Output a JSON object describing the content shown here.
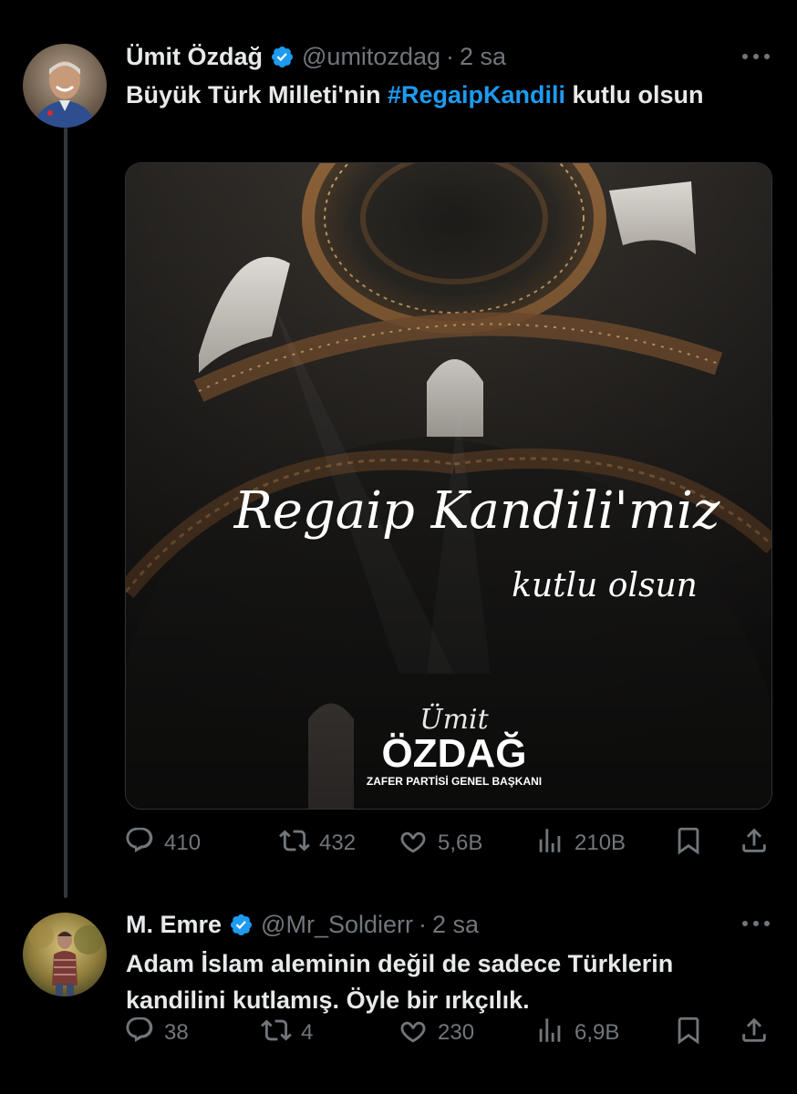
{
  "tweets": [
    {
      "name": "Ümit Özdağ",
      "handle": "@umitozdag",
      "separator": "·",
      "time": "2 sa",
      "text_before": "Büyük Türk Milleti'nin ",
      "hashtag": "#RegaipKandili",
      "text_after": " kutlu olsun",
      "media": {
        "title": "Regaip Kandili'miz",
        "subtitle": "kutlu olsun",
        "logo_script": "Ümit",
        "logo_name": "ÖZDAĞ",
        "logo_caption": "ZAFER PARTİSİ GENEL BAŞKANI"
      },
      "stats": {
        "replies": "410",
        "reposts": "432",
        "likes": "5,6B",
        "views": "210B"
      }
    },
    {
      "name": "M. Emre",
      "handle": "@Mr_Soldierr",
      "separator": "·",
      "time": "2 sa",
      "text": "Adam İslam aleminin değil de sadece Türklerin kandilini kutlamış. Öyle bir ırkçılık.",
      "stats": {
        "replies": "38",
        "reposts": "4",
        "likes": "230",
        "views": "6,9B"
      }
    }
  ],
  "icons": {
    "verified": "verified-badge-icon",
    "more": "more-horizontal-icon",
    "reply": "reply-icon",
    "repost": "repost-icon",
    "like": "heart-icon",
    "views": "views-icon",
    "bookmark": "bookmark-icon",
    "share": "share-icon"
  },
  "colors": {
    "background": "#000000",
    "text": "#e7e9ea",
    "muted": "#71767b",
    "accent": "#1d9bf0",
    "thread_line": "#333639"
  }
}
